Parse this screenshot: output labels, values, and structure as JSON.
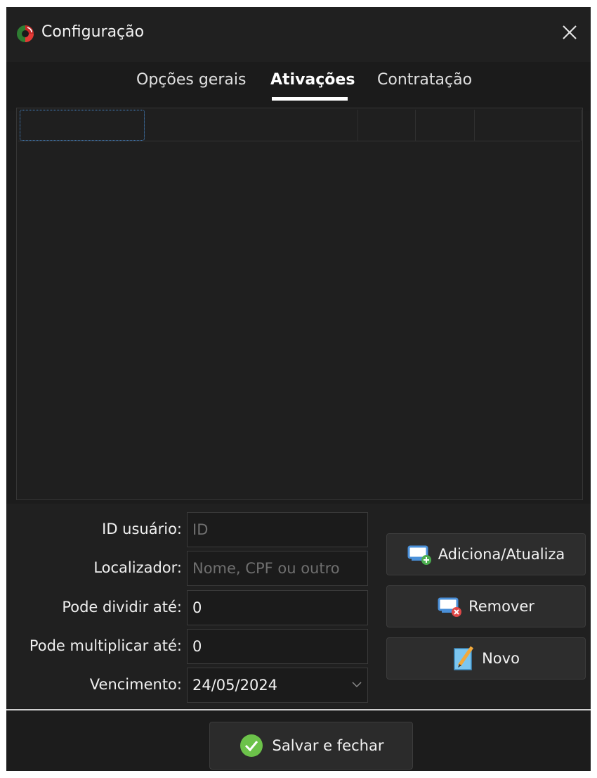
{
  "window": {
    "title": "Configuração",
    "close_glyph": "✕"
  },
  "tabs": [
    {
      "label": "Opções gerais",
      "active": false
    },
    {
      "label": "Ativações",
      "active": true
    },
    {
      "label": "Contratação",
      "active": false
    }
  ],
  "form": {
    "id_usuario": {
      "label": "ID usuário:",
      "value": "",
      "placeholder": "ID"
    },
    "localizador": {
      "label": "Localizador:",
      "value": "",
      "placeholder": "Nome, CPF ou outro"
    },
    "pode_dividir": {
      "label": "Pode dividir até:",
      "value": "0"
    },
    "pode_multiplicar": {
      "label": "Pode multiplicar até:",
      "value": "0"
    },
    "vencimento": {
      "label": "Vencimento:",
      "value": "24/05/2024"
    }
  },
  "buttons": {
    "add_update": {
      "label": "Adiciona/Atualiza",
      "icon": "monitor-add-icon"
    },
    "remove": {
      "label": "Remover",
      "icon": "monitor-remove-icon"
    },
    "new": {
      "label": "Novo",
      "icon": "notepad-pencil-icon"
    },
    "save_close": {
      "label": "Salvar e fechar",
      "icon": "check-circle-icon"
    }
  },
  "colors": {
    "background": "#1c1c1c",
    "accent_green": "#6cc24a",
    "remove_red": "#e04848",
    "focus_blue": "#4a90d9"
  }
}
